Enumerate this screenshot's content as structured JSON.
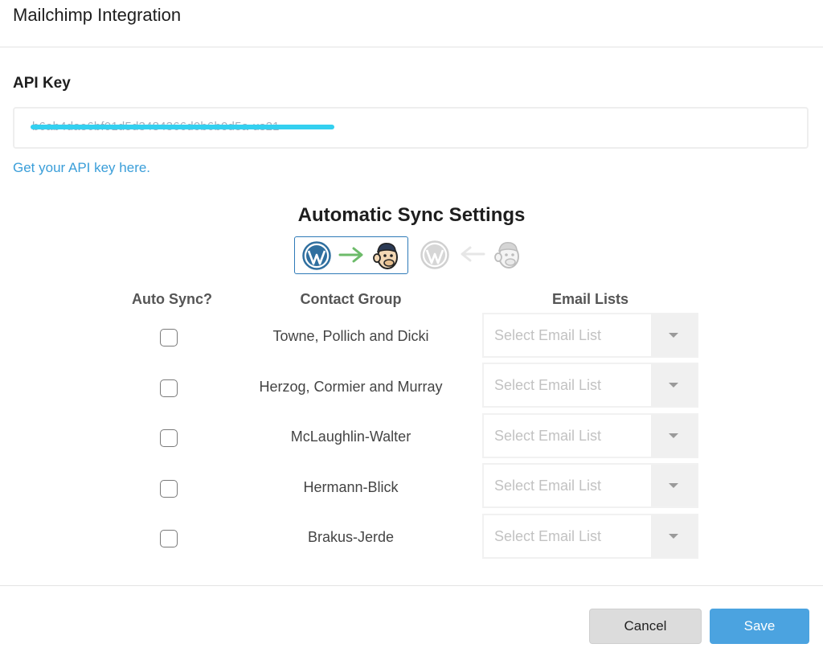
{
  "dialog": {
    "title": "Mailchimp Integration"
  },
  "api": {
    "label": "API Key",
    "value": "b6ab4dae6bf01d5d3484366d0b6b0d5a-us21",
    "link_text": "Get your API key here."
  },
  "sync": {
    "title": "Automatic Sync Settings",
    "directions": [
      {
        "name": "wordpress-to-mailchimp",
        "selected": true
      },
      {
        "name": "mailchimp-to-wordpress",
        "selected": false
      }
    ]
  },
  "table": {
    "headers": {
      "auto_sync": "Auto Sync?",
      "contact_group": "Contact Group",
      "email_lists": "Email Lists"
    },
    "rows": [
      {
        "group": "Towne, Pollich and Dicki",
        "checked": false,
        "email_list_placeholder": "Select Email List"
      },
      {
        "group": "Herzog, Cormier and Murray",
        "checked": false,
        "email_list_placeholder": "Select Email List"
      },
      {
        "group": "McLaughlin-Walter",
        "checked": false,
        "email_list_placeholder": "Select Email List"
      },
      {
        "group": "Hermann-Blick",
        "checked": false,
        "email_list_placeholder": "Select Email List"
      },
      {
        "group": "Brakus-Jerde",
        "checked": false,
        "email_list_placeholder": "Select Email List"
      }
    ]
  },
  "footer": {
    "cancel_label": "Cancel",
    "save_label": "Save"
  },
  "colors": {
    "accent": "#2e7ab8",
    "link": "#3a9ed9",
    "save_button": "#4ba3e0",
    "arrow_active": "#6dbb6a",
    "redaction": "#33d0f0"
  },
  "icons": {
    "wordpress": "wordpress-logo-icon",
    "mailchimp": "mailchimp-freddie-icon",
    "arrow_right": "arrow-right-icon",
    "arrow_left": "arrow-left-icon",
    "dropdown": "chevron-down-icon"
  }
}
